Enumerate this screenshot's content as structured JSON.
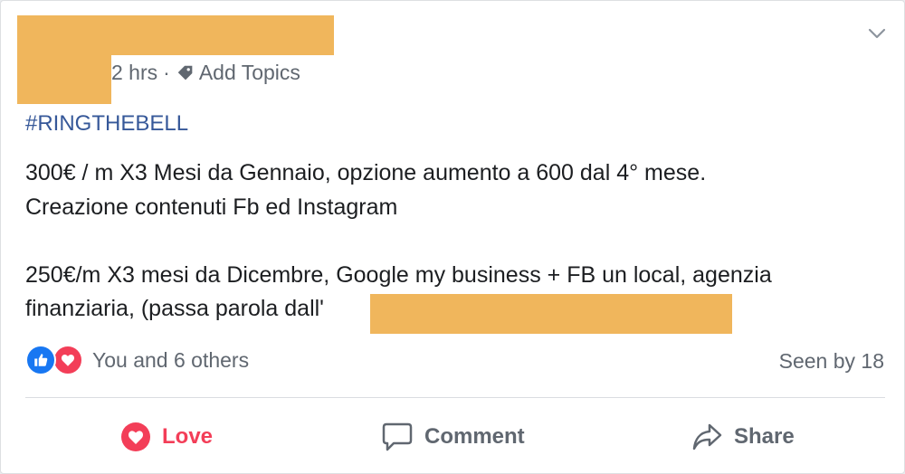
{
  "post": {
    "timestamp": "2 hrs",
    "separator": "·",
    "add_topics": "Add Topics",
    "hashtag": "#RINGTHEBELL",
    "body_lines": [
      "300€ / m X3 Mesi da Gennaio, opzione aumento a 600 dal 4° mese.",
      "Creazione contenuti  Fb ed Instagram",
      "",
      "250€/m X3 mesi da Dicembre, Google my business + FB un local, agenzia",
      "finanziaria, (passa parola dall'"
    ]
  },
  "reactions": {
    "summary": "You and 6 others",
    "seen": "Seen by 18",
    "icons": [
      "like-icon",
      "love-icon"
    ]
  },
  "actions": {
    "love": "Love",
    "comment": "Comment",
    "share": "Share"
  },
  "colors": {
    "redaction": "#f0b65c",
    "link": "#365899",
    "love": "#f33e58",
    "like": "#1877f2",
    "secondary_text": "#606770"
  }
}
